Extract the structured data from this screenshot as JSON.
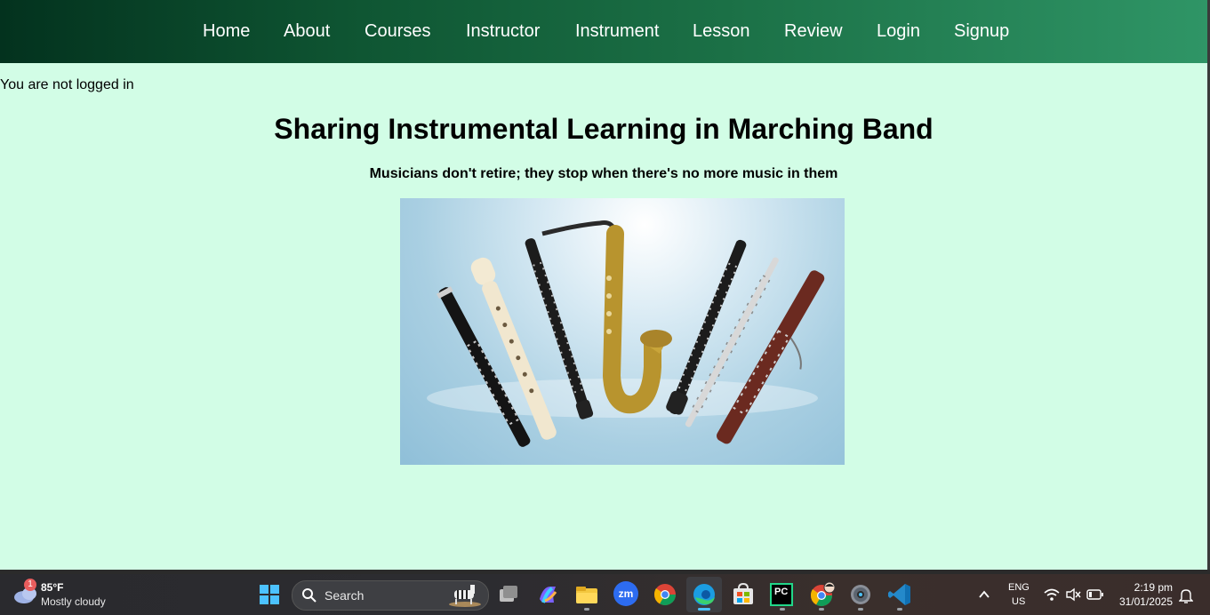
{
  "nav": {
    "items": [
      {
        "label": "Home"
      },
      {
        "label": "About"
      },
      {
        "label": "Courses"
      },
      {
        "label": "Instructor"
      },
      {
        "label": "Instrument"
      },
      {
        "label": "Lesson"
      },
      {
        "label": "Review"
      },
      {
        "label": "Login"
      },
      {
        "label": "Signup"
      }
    ]
  },
  "status": {
    "login_text": "You are not logged in"
  },
  "hero": {
    "title": "Sharing Instrumental Learning in Marching Band",
    "subtitle": "Musicians don't retire; they stop when there's no more music in them",
    "image_icon": "woodwind-instruments-photo"
  },
  "taskbar": {
    "weather": {
      "badge": "1",
      "temp": "85°F",
      "condition": "Mostly cloudy",
      "icon": "cloud-icon"
    },
    "search_label": "Search",
    "apps": [
      "windows-start-icon",
      "search-icon",
      "task-view-icon",
      "copilot-icon",
      "file-explorer-icon",
      "zoom-icon",
      "chrome-icon",
      "edge-icon",
      "store-icon",
      "pycharm-icon",
      "chrome-profile-icon",
      "settings-icon",
      "vscode-icon"
    ],
    "zoom_text": "zm",
    "pycharm_text": "PC",
    "lang_line1": "ENG",
    "lang_line2": "US",
    "time": "2:19 pm",
    "date": "31/01/2025"
  },
  "colors": {
    "page_bg": "#d2fde6",
    "nav_start": "#03321e",
    "nav_end": "#2f9566"
  }
}
